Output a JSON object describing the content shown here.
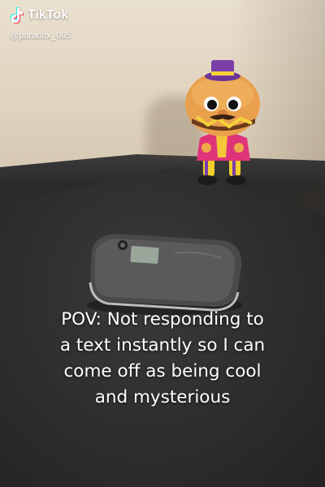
{
  "app": {
    "name": "TikTok",
    "username": "@paradox_005"
  },
  "caption_lines": [
    "POV: Not responding to",
    "a text instantly so I can",
    "come off as being cool",
    "and mysterious"
  ],
  "icons": {
    "brand": "tiktok-logo-icon"
  },
  "colors": {
    "caption_text": "#ffffff",
    "desk": "#2d2d2d",
    "wall": "#e6dac6",
    "figure_body": "#e0347a",
    "figure_head": "#f0a74a",
    "hat": "#7a3fa8"
  }
}
